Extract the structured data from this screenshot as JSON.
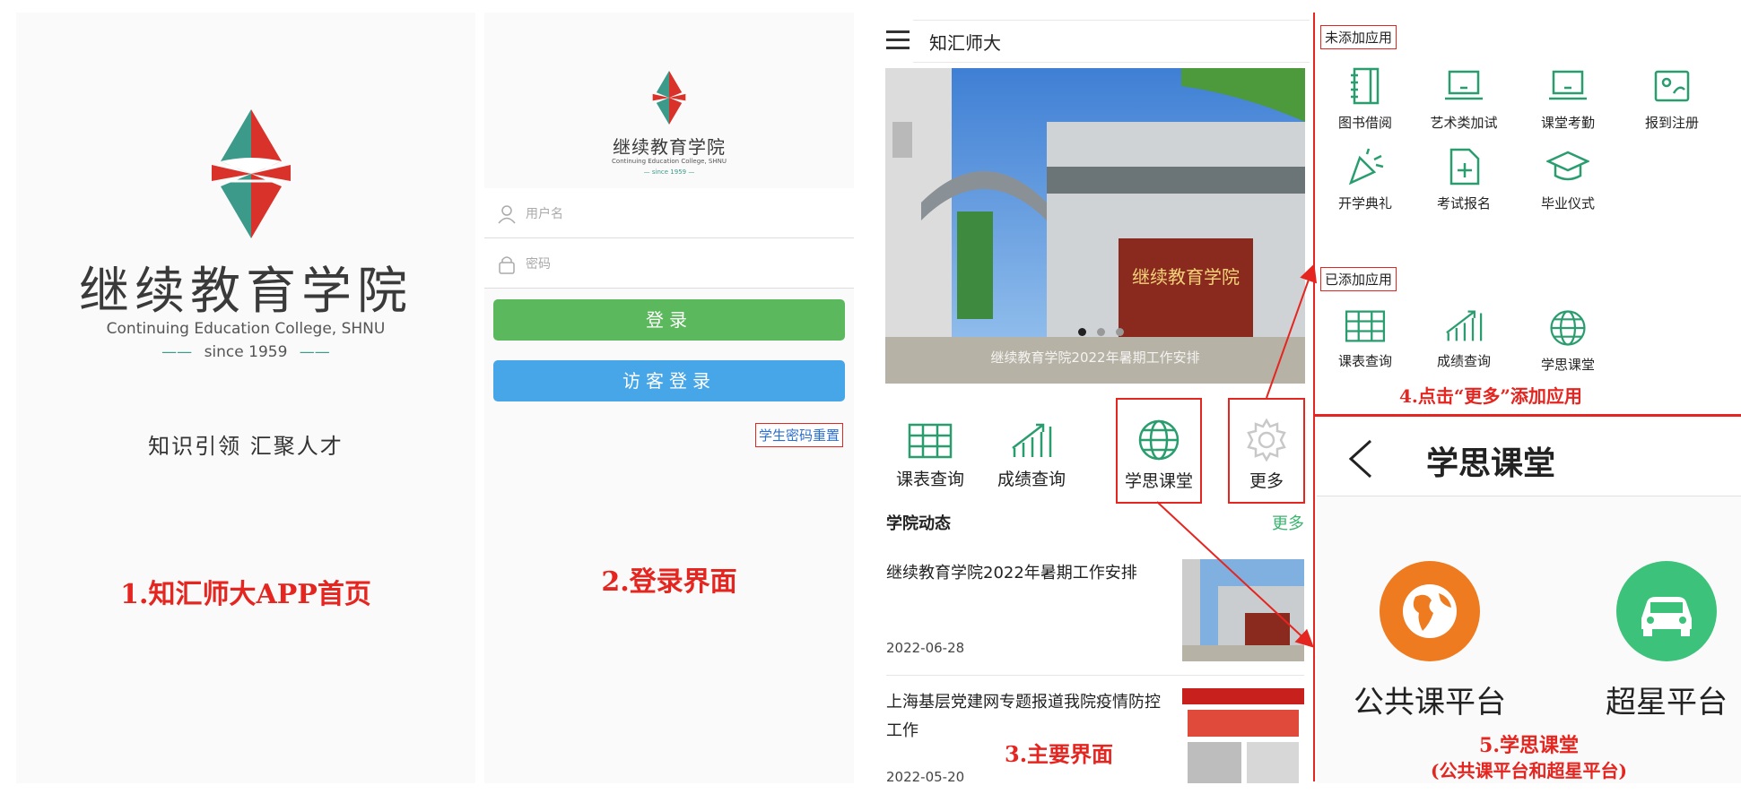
{
  "colors": {
    "accent_red": "#e5251f",
    "green": "#5cb85c",
    "blue": "#47a6e8",
    "teal": "#3b9a8a",
    "orange": "#ee7b1f",
    "platform_green": "#3cc27a"
  },
  "splash": {
    "title": "继续教育学院",
    "subtitle": "Continuing Education College, SHNU",
    "since": "since 1959",
    "slogan": "知识引领 汇聚人才",
    "caption": "1.知汇师大APP首页"
  },
  "login": {
    "title": "继续教育学院",
    "subtitle": "Continuing Education College, SHNU",
    "since": "since 1959",
    "username_placeholder": "用户名",
    "password_placeholder": "密码",
    "login_label": "登录",
    "guest_label": "访客登录",
    "reset_link": "学生密码重置",
    "caption": "2.登录界面"
  },
  "main": {
    "app_title": "知汇师大",
    "banner_caption": "继续教育学院2022年暑期工作安排",
    "quick_actions": [
      {
        "label": "课表查询",
        "icon": "table-icon"
      },
      {
        "label": "成绩查询",
        "icon": "chart-icon"
      },
      {
        "label": "学思课堂",
        "icon": "globe-icon"
      },
      {
        "label": "更多",
        "icon": "gear-icon"
      }
    ],
    "news_heading": "学院动态",
    "news_more": "更多",
    "news": [
      {
        "title": "继续教育学院2022年暑期工作安排",
        "date": "2022-06-28"
      },
      {
        "title": "上海基层党建网专题报道我院疫情防控工作",
        "date": "2022-05-20"
      }
    ],
    "caption": "3.主要界面"
  },
  "apps": {
    "unadded_label": "未添加应用",
    "unadded": [
      {
        "label": "图书借阅",
        "icon": "notebook-icon"
      },
      {
        "label": "艺术类加试",
        "icon": "laptop-icon"
      },
      {
        "label": "课堂考勤",
        "icon": "laptop-icon"
      },
      {
        "label": "报到注册",
        "icon": "map-icon"
      },
      {
        "label": "开学典礼",
        "icon": "party-icon"
      },
      {
        "label": "考试报名",
        "icon": "add-file-icon"
      },
      {
        "label": "毕业仪式",
        "icon": "graduation-cap-icon"
      }
    ],
    "added_label": "已添加应用",
    "added": [
      {
        "label": "课表查询",
        "icon": "table-icon"
      },
      {
        "label": "成绩查询",
        "icon": "chart-icon"
      },
      {
        "label": "学思课堂",
        "icon": "globe-icon"
      }
    ],
    "caption": "4.点击“更多”添加应用"
  },
  "xuesi": {
    "title": "学思课堂",
    "platforms": [
      {
        "label": "公共课平台",
        "icon": "earth-icon"
      },
      {
        "label": "超星平台",
        "icon": "car-icon"
      }
    ],
    "caption_line1": "5.学思课堂",
    "caption_line2": "(公共课平台和超星平台)"
  }
}
